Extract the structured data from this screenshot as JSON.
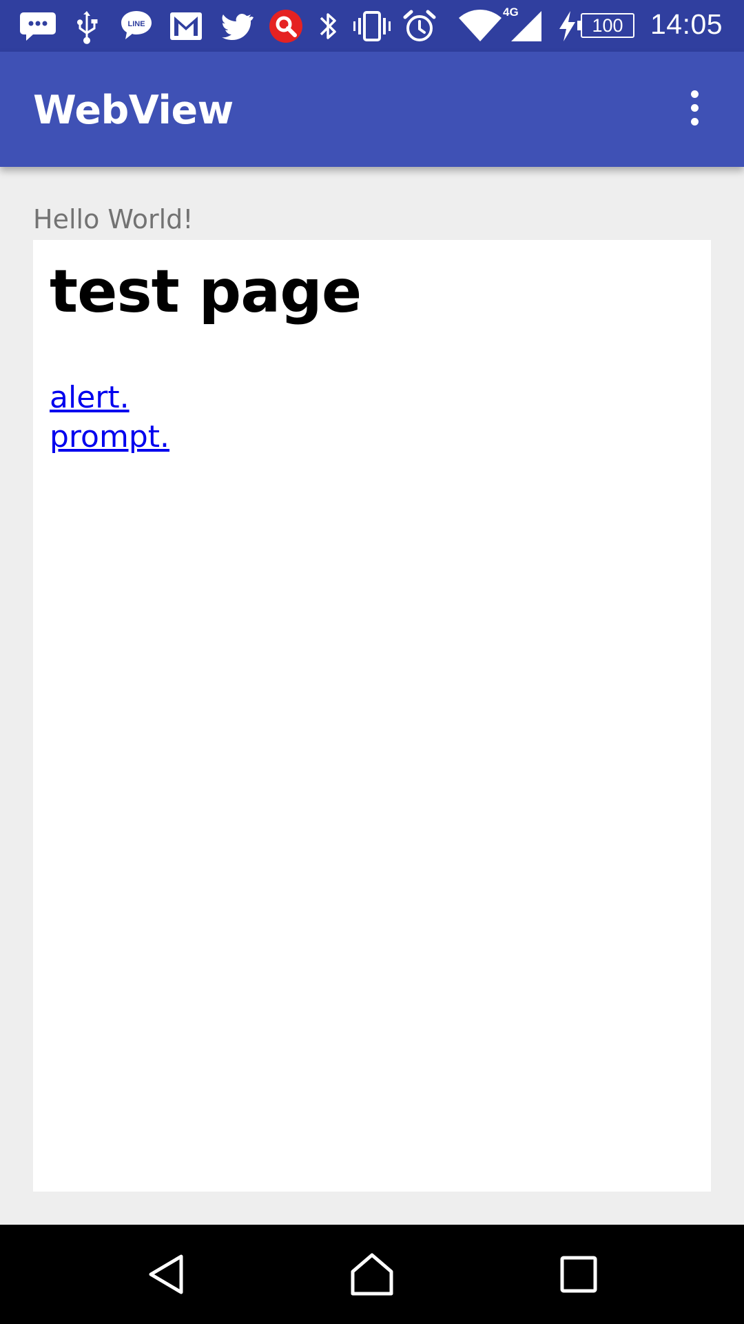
{
  "status_bar": {
    "icons": [
      "messenger-notification-icon",
      "usb-icon",
      "line-app-icon",
      "gmail-icon",
      "twitter-icon",
      "search-app-icon",
      "bluetooth-icon",
      "vibrate-icon",
      "alarm-icon",
      "wifi-icon",
      "cell-signal-icon",
      "charging-icon"
    ],
    "network_type": "4G",
    "battery_level": "100",
    "time": "14:05",
    "colors": {
      "background": "#303f9f"
    }
  },
  "app_bar": {
    "title": "WebView",
    "menu_icon": "overflow-menu-icon",
    "colors": {
      "background": "#3f51b5",
      "text": "#ffffff"
    }
  },
  "content": {
    "hello_text": "Hello World!",
    "webview": {
      "heading": "test page",
      "links": [
        {
          "label": "alert."
        },
        {
          "label": "prompt."
        }
      ],
      "colors": {
        "link": "#0000ee"
      }
    }
  },
  "nav_bar": {
    "buttons": [
      "back-icon",
      "home-icon",
      "recents-icon"
    ]
  }
}
